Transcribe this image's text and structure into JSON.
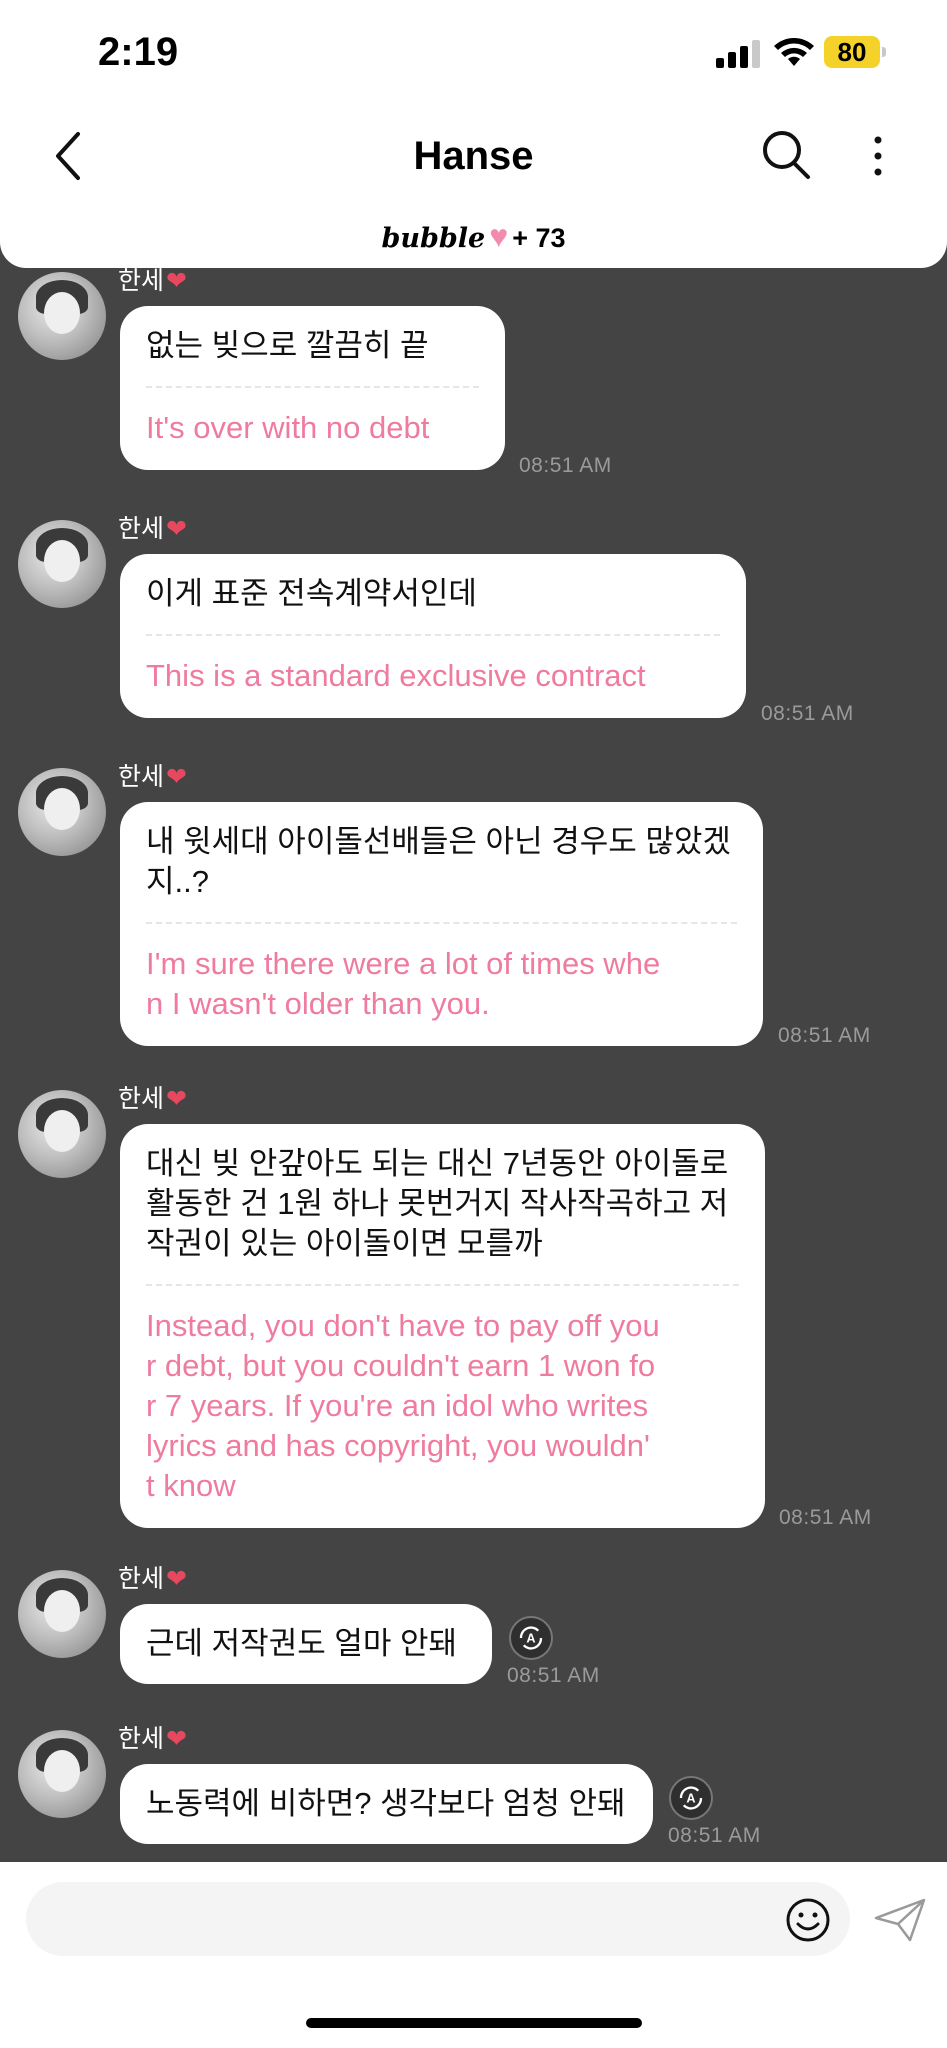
{
  "status_bar": {
    "time": "2:19",
    "battery": "80"
  },
  "header": {
    "title": "Hanse",
    "bubble_logo": "bubble",
    "bubble_heart": "♥",
    "bubble_count": "+ 73"
  },
  "sender_name": "한세",
  "sender_heart": "❤",
  "messages": [
    {
      "korean": "없는 빚으로 깔끔히 끝",
      "english": "It's over with no debt",
      "time": "08:51 AM"
    },
    {
      "korean": "이게 표준 전속계약서인데",
      "english": "This is a standard exclusive contract",
      "time": "08:51 AM"
    },
    {
      "korean": "내 윗세대 아이돌선배들은 아닌 경우도 많았겠\n지..?",
      "english": "I'm sure there were a lot of times whe\nn I wasn't older than you.",
      "time": "08:51 AM"
    },
    {
      "korean": "대신 빚 안갚아도 되는 대신 7년동안 아이돌로\n활동한 건 1원 하나 못번거지 작사작곡하고 저\n작권이 있는 아이돌이면 모를까",
      "english": "Instead, you don't have to pay off you\nr debt, but you couldn't earn 1 won fo\nr 7 years. If you're an idol who writes\nlyrics and has copyright, you wouldn'\nt know",
      "time": "08:51 AM"
    },
    {
      "korean": "근데 저작권도 얼마 안돼",
      "time": "08:51 AM"
    },
    {
      "korean": "노동력에 비하면? 생각보다 엄청 안돼",
      "time": "08:51 AM"
    }
  ],
  "input": {
    "placeholder": ""
  },
  "icons": {
    "back": "chevron-left-icon",
    "search": "search-icon",
    "more": "more-vertical-icon",
    "translate": "translate-icon",
    "emoji": "smiley-icon",
    "send": "send-icon"
  },
  "colors": {
    "translation_text": "#ef7b9f",
    "chat_background": "#444444",
    "battery": "#f5d22a"
  }
}
